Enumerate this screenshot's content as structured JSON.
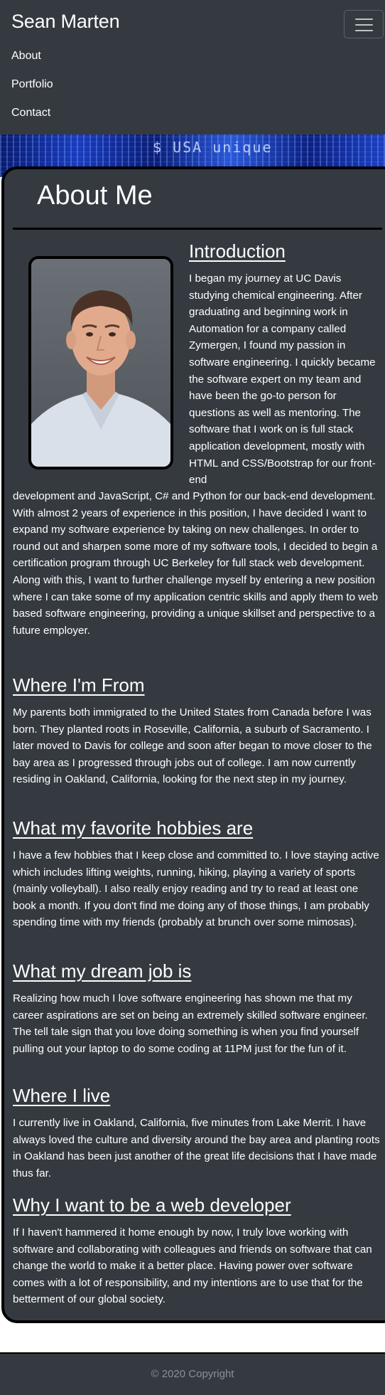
{
  "navbar": {
    "brand": "Sean Marten",
    "toggler_icon": "hamburger-icon",
    "links": [
      "About",
      "Portfolio",
      "Contact"
    ]
  },
  "banner": {
    "text": "$ USA unique"
  },
  "about": {
    "title": "About Me",
    "photo_alt": "portrait-photo",
    "sections": [
      {
        "heading": "Introduction",
        "text_wrap": "I began my journey at UC Davis studying chemical engineering. After graduating and beginning work in Automation for a company called Zymergen, I found my passion in software engineering. I quickly became the software expert on my team and have been the go-to person for questions as well as mentoring. The software that I work on is full stack application development, mostly with HTML and CSS/Bootstrap for our front-end",
        "text_full": "development and JavaScript, C# and Python for our back-end development. With almost 2 years of experience in this position, I have decided I want to expand my software experience by taking on new challenges. In order to round out and sharpen some more of my software tools, I decided to begin a certification program through UC Berkeley for full stack web development. Along with this, I want to further challenge myself by entering a new position where I can take some of my application centric skills and apply them to web based software engineering, providing a unique skillset and perspective to a future employer."
      },
      {
        "heading": "Where I'm From",
        "text": "My parents both immigrated to the United States from Canada before I was born. They planted roots in Roseville, California, a suburb of Sacramento. I later moved to Davis for college and soon after began to move closer to the bay area as I progressed through jobs out of college. I am now currently residing in Oakland, California, looking for the next step in my journey."
      },
      {
        "heading": "What my favorite hobbies are",
        "text": "I have a few hobbies that I keep close and committed to. I love staying active which includes lifting weights, running, hiking, playing a variety of sports (mainly volleyball). I also really enjoy reading and try to read at least one book a month. If you don't find me doing any of those things, I am probably spending time with my friends (probably at brunch over some mimosas)."
      },
      {
        "heading": "What my dream job is",
        "text": "Realizing how much I love software engineering has shown me that my career aspirations are set on being an extremely skilled software engineer. The tell tale sign that you love doing something is when you find yourself pulling out your laptop to do some coding at 11PM just for the fun of it."
      },
      {
        "heading": "Where I live",
        "text": "I currently live in Oakland, California, five minutes from Lake Merrit. I have always loved the culture and diversity around the bay area and planting roots in Oakland has been just another of the great life decisions that I have made thus far."
      },
      {
        "heading": "Why I want to be a web developer",
        "text": "If I haven't hammered it home enough by now, I truly love working with software and collaborating with colleagues and friends on software that can change the world to make it a better place. Having power over software comes with a lot of responsibility, and my intentions are to use that for the betterment of our global society."
      }
    ]
  },
  "footer": {
    "copyright": "© 2020 Copyright"
  },
  "colors": {
    "navbar_bg": "#343a40",
    "card_bg": "#343a40",
    "card_border": "#000000",
    "footer_text": "#8a9096"
  }
}
